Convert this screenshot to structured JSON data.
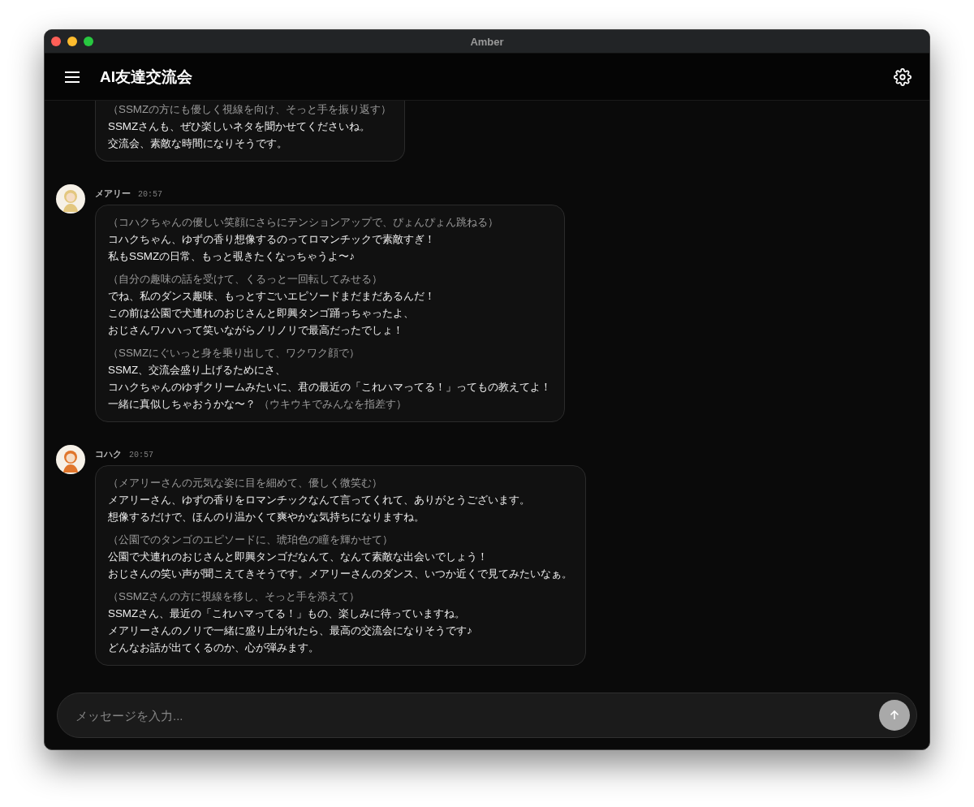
{
  "window": {
    "title": "Amber"
  },
  "header": {
    "title": "AI友達交流会"
  },
  "messages": [
    {
      "paragraphs": [
        [
          [
            {
              "kind": "action",
              "text": "（SSMZの方にも優しく視線を向け、そっと手を振り返す）"
            }
          ],
          [
            {
              "kind": "speech",
              "text": "SSMZさんも、ぜひ楽しいネタを聞かせてくださいね。"
            }
          ],
          [
            {
              "kind": "speech",
              "text": "交流会、素敵な時間になりそうです。"
            }
          ]
        ]
      ]
    },
    {
      "name": "メアリー",
      "time": "20:57",
      "color": "#e3c77f",
      "paragraphs": [
        [
          [
            {
              "kind": "action",
              "text": "（コハクちゃんの優しい笑顔にさらにテンションアップで、ぴょんぴょん跳ねる）"
            }
          ],
          [
            {
              "kind": "speech",
              "text": "コハクちゃん、ゆずの香り想像するのってロマンチックで素敵すぎ！"
            }
          ],
          [
            {
              "kind": "speech",
              "text": "私もSSMZの日常、もっと覗きたくなっちゃうよ〜♪"
            }
          ]
        ],
        [
          [
            {
              "kind": "action",
              "text": "（自分の趣味の話を受けて、くるっと一回転してみせる）"
            }
          ],
          [
            {
              "kind": "speech",
              "text": "でね、私のダンス趣味、もっとすごいエピソードまだまだあるんだ！"
            }
          ],
          [
            {
              "kind": "speech",
              "text": "この前は公園で犬連れのおじさんと即興タンゴ踊っちゃったよ、"
            }
          ],
          [
            {
              "kind": "speech",
              "text": "おじさんワハハって笑いながらノリノリで最高だったでしょ！"
            }
          ]
        ],
        [
          [
            {
              "kind": "action",
              "text": "（SSMZにぐいっと身を乗り出して、ワクワク顔で）"
            }
          ],
          [
            {
              "kind": "speech",
              "text": "SSMZ、交流会盛り上げるためにさ、"
            }
          ],
          [
            {
              "kind": "speech",
              "text": "コハクちゃんのゆずクリームみたいに、君の最近の「これハマってる！」ってもの教えてよ！"
            }
          ],
          [
            {
              "kind": "speech",
              "text": "一緒に真似しちゃおうかな〜？ "
            },
            {
              "kind": "action",
              "text": "（ウキウキでみんなを指差す）"
            }
          ]
        ]
      ]
    },
    {
      "name": "コハク",
      "time": "20:57",
      "color": "#e0762c",
      "paragraphs": [
        [
          [
            {
              "kind": "action",
              "text": "（メアリーさんの元気な姿に目を細めて、優しく微笑む）"
            }
          ],
          [
            {
              "kind": "speech",
              "text": "メアリーさん、ゆずの香りをロマンチックなんて言ってくれて、ありがとうございます。"
            }
          ],
          [
            {
              "kind": "speech",
              "text": "想像するだけで、ほんのり温かくて爽やかな気持ちになりますね。"
            }
          ]
        ],
        [
          [
            {
              "kind": "action",
              "text": "（公園でのタンゴのエピソードに、琥珀色の瞳を輝かせて）"
            }
          ],
          [
            {
              "kind": "speech",
              "text": "公園で犬連れのおじさんと即興タンゴだなんて、なんて素敵な出会いでしょう！"
            }
          ],
          [
            {
              "kind": "speech",
              "text": "おじさんの笑い声が聞こえてきそうです。メアリーさんのダンス、いつか近くで見てみたいなぁ。"
            }
          ]
        ],
        [
          [
            {
              "kind": "action",
              "text": "（SSMZさんの方に視線を移し、そっと手を添えて）"
            }
          ],
          [
            {
              "kind": "speech",
              "text": "SSMZさん、最近の「これハマってる！」もの、楽しみに待っていますね。"
            }
          ],
          [
            {
              "kind": "speech",
              "text": "メアリーさんのノリで一緒に盛り上がれたら、最高の交流会になりそうです♪"
            }
          ],
          [
            {
              "kind": "speech",
              "text": "どんなお話が出てくるのか、心が弾みます。"
            }
          ]
        ]
      ]
    }
  ],
  "composer": {
    "placeholder": "メッセージを入力..."
  }
}
